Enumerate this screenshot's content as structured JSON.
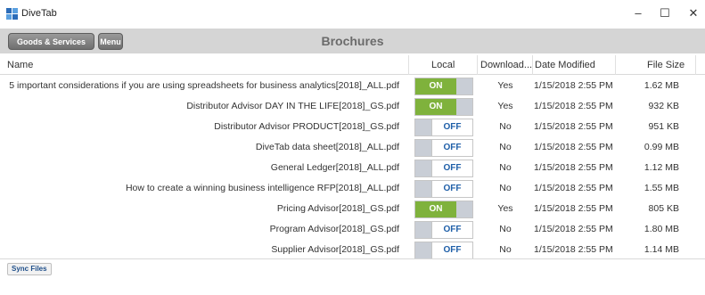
{
  "window": {
    "title": "DiveTab",
    "icon": "divetab-logo-icon",
    "minimize_glyph": "–",
    "maximize_glyph": "☐",
    "close_glyph": "✕"
  },
  "toolbar": {
    "goods_button": "Goods & Services",
    "menu_button": "Menu",
    "title": "Brochures"
  },
  "table": {
    "headers": {
      "name": "Name",
      "local": "Local",
      "download": "Download...",
      "date": "Date Modified",
      "size": "File Size"
    },
    "rows": [
      {
        "name": "5 important considerations if you are using spreadsheets for business analytics[2018]_ALL.pdf",
        "local": "ON",
        "download": "Yes",
        "date": "1/15/2018 2:55 PM",
        "size": "1.62 MB"
      },
      {
        "name": "Distributor Advisor DAY IN THE LIFE[2018]_GS.pdf",
        "local": "ON",
        "download": "Yes",
        "date": "1/15/2018 2:55 PM",
        "size": "932 KB"
      },
      {
        "name": "Distributor Advisor PRODUCT[2018]_GS.pdf",
        "local": "OFF",
        "download": "No",
        "date": "1/15/2018 2:55 PM",
        "size": "951 KB"
      },
      {
        "name": "DiveTab data sheet[2018]_ALL.pdf",
        "local": "OFF",
        "download": "No",
        "date": "1/15/2018 2:55 PM",
        "size": "0.99 MB"
      },
      {
        "name": "General Ledger[2018]_ALL.pdf",
        "local": "OFF",
        "download": "No",
        "date": "1/15/2018 2:55 PM",
        "size": "1.12 MB"
      },
      {
        "name": "How to create a winning business intelligence RFP[2018]_ALL.pdf",
        "local": "OFF",
        "download": "No",
        "date": "1/15/2018 2:55 PM",
        "size": "1.55 MB"
      },
      {
        "name": "Pricing Advisor[2018]_GS.pdf",
        "local": "ON",
        "download": "Yes",
        "date": "1/15/2018 2:55 PM",
        "size": "805 KB"
      },
      {
        "name": "Program Advisor[2018]_GS.pdf",
        "local": "OFF",
        "download": "No",
        "date": "1/15/2018 2:55 PM",
        "size": "1.80 MB"
      },
      {
        "name": "Supplier Advisor[2018]_GS.pdf",
        "local": "OFF",
        "download": "No",
        "date": "1/15/2018 2:55 PM",
        "size": "1.14 MB"
      }
    ]
  },
  "footer": {
    "sync_button": "Sync Files"
  },
  "colors": {
    "on": "#7fb23c",
    "off_text": "#1f5fa8",
    "toolbar": "#d5d5d5"
  }
}
